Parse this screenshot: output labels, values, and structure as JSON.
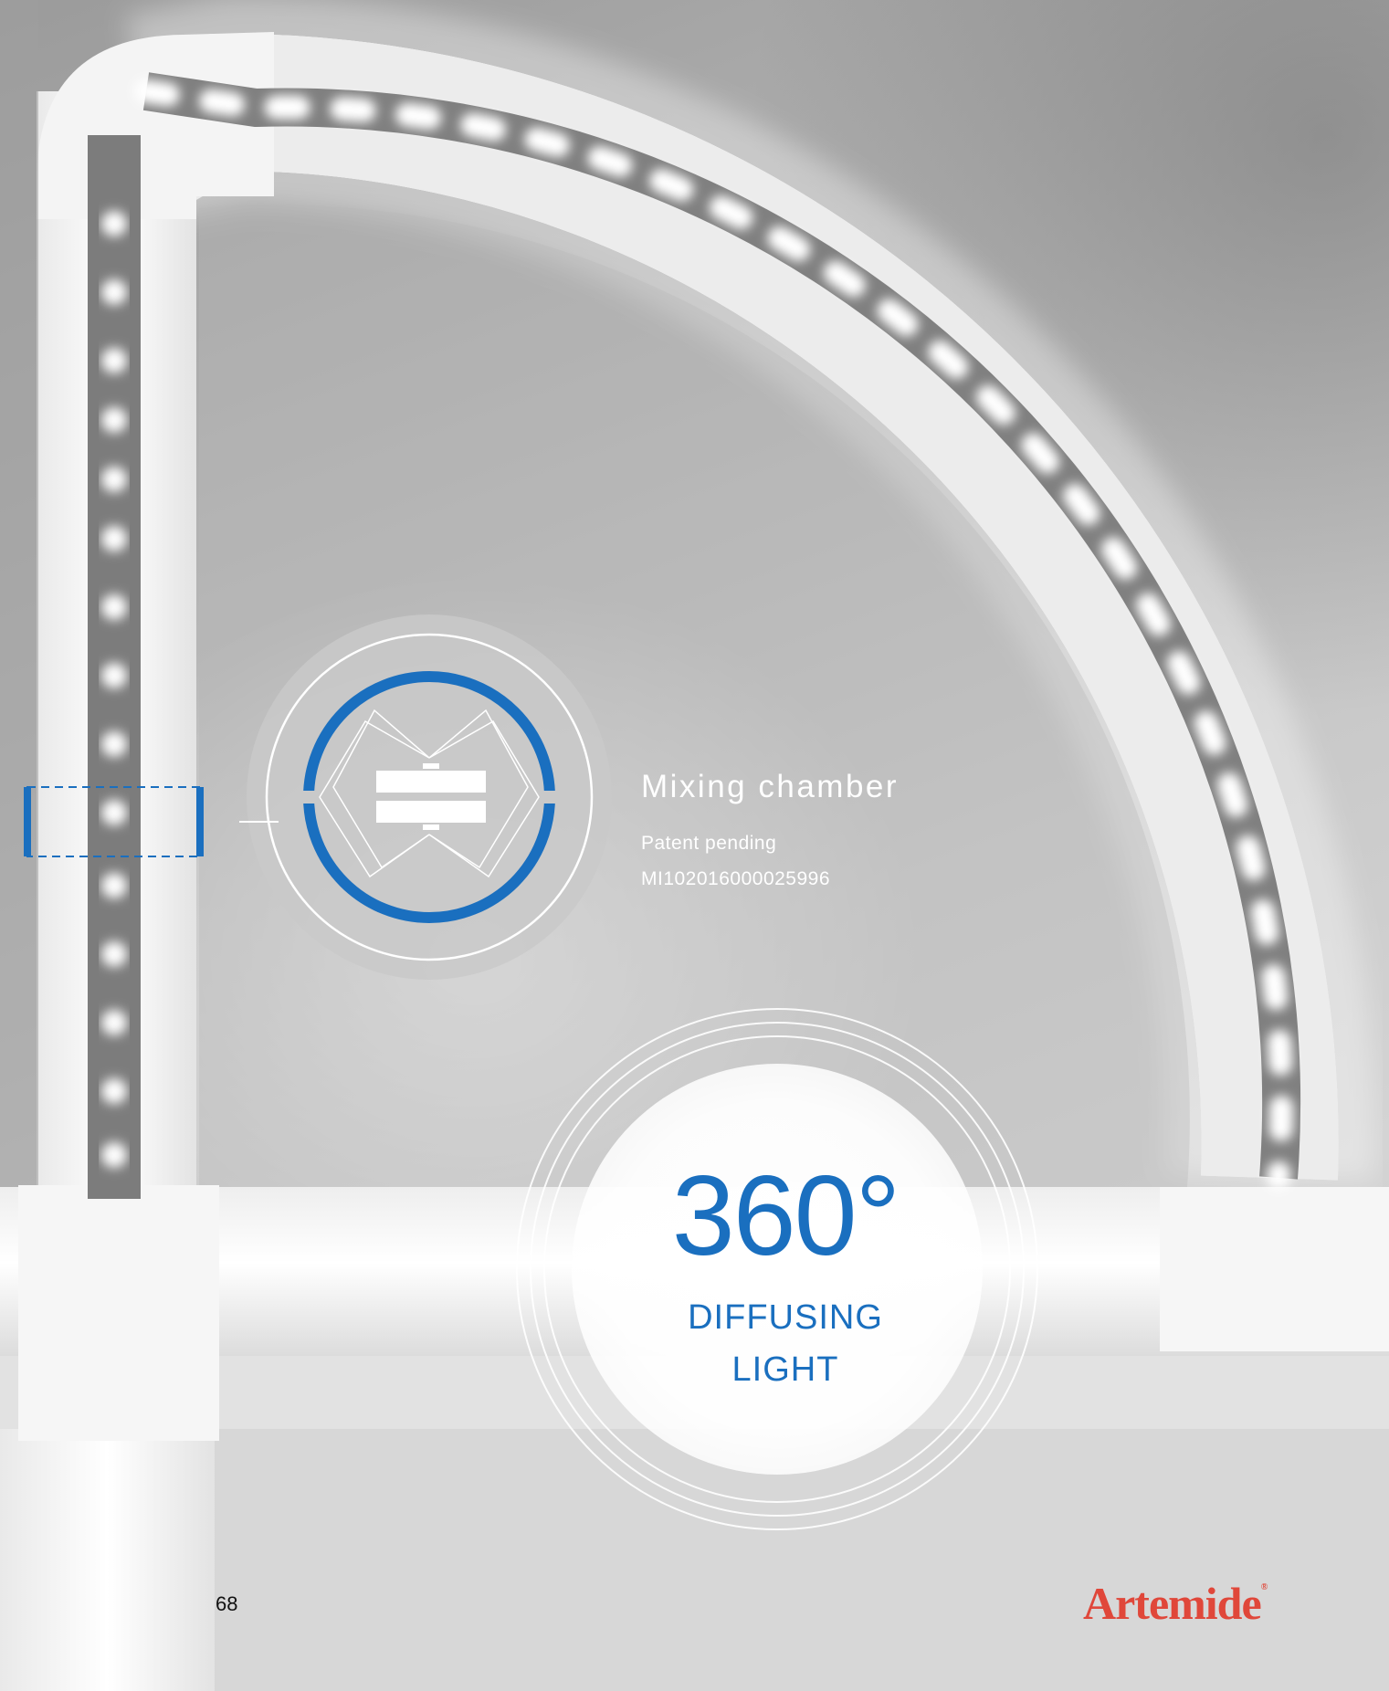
{
  "mixing_chamber": {
    "title": "Mixing chamber",
    "patent_label": "Patent pending",
    "patent_number": "MI102016000025996"
  },
  "feature": {
    "number": "360°",
    "line1": "DIFFUSING",
    "line2": "LIGHT"
  },
  "page_number": "68",
  "brand": {
    "name": "Artemide",
    "reg_mark": "®"
  },
  "colors": {
    "accent_blue": "#1a6fbf",
    "brand_red": "#e0473a",
    "text_white": "#ffffff"
  },
  "icons": [
    "mixing-chamber-diagram-icon",
    "detail-marker-icon"
  ]
}
